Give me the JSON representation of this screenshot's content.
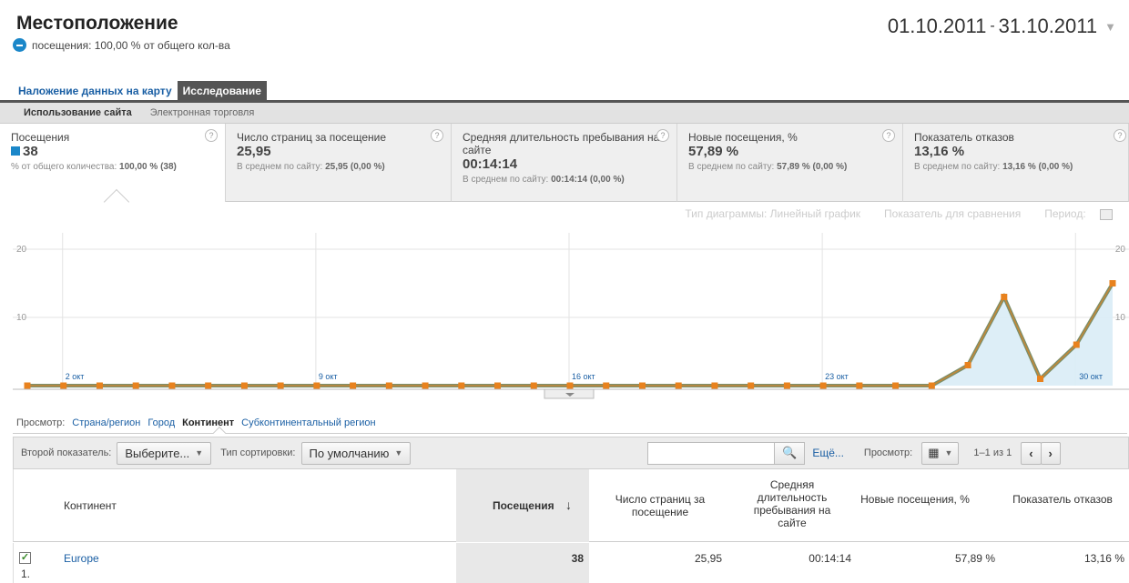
{
  "header": {
    "title": "Местоположение",
    "segment_label": "посещения: 100,00 % от общего кол-ва",
    "date_start": "01.10.2011",
    "date_sep": "-",
    "date_end": "31.10.2011"
  },
  "tabs": [
    {
      "label": "Наложение данных на карту"
    },
    {
      "label": "Исследование"
    }
  ],
  "subtabs": [
    {
      "label": "Использование сайта"
    },
    {
      "label": "Электронная торговля"
    }
  ],
  "metrics": [
    {
      "name": "Посещения",
      "value": "38",
      "sub": "% от общего количества: ",
      "sub_bold": "100,00 % (38)"
    },
    {
      "name": "Число страниц за посещение",
      "value": "25,95",
      "sub": "В среднем по сайту: ",
      "sub_bold": "25,95 (0,00 %)"
    },
    {
      "name": "Средняя длительность пребывания на сайте",
      "value": "00:14:14",
      "sub": "В среднем по сайту: ",
      "sub_bold": "00:14:14 (0,00 %)"
    },
    {
      "name": "Новые посещения, %",
      "value": "57,89 %",
      "sub": "В среднем по сайту: ",
      "sub_bold": "57,89 % (0,00 %)"
    },
    {
      "name": "Показатель отказов",
      "value": "13,16 %",
      "sub": "В среднем по сайту: ",
      "sub_bold": "13,16 % (0,00 %)"
    }
  ],
  "help_glyph": "?",
  "chart_tools": {
    "chart_type": "Тип диаграммы:",
    "line_chart": "Линейный график",
    "compare": "Показатель для сравнения",
    "period": "Период:"
  },
  "chart_data": {
    "type": "area",
    "ylim": [
      0,
      20
    ],
    "yticks_left": [
      "20",
      "10"
    ],
    "yticks_right": [
      "20",
      "10"
    ],
    "x_labels": [
      "2 окт",
      "9 окт",
      "16 окт",
      "23 окт",
      "30 окт"
    ],
    "x_label_days": [
      2,
      9,
      16,
      23,
      30
    ],
    "days": [
      1,
      2,
      3,
      4,
      5,
      6,
      7,
      8,
      9,
      10,
      11,
      12,
      13,
      14,
      15,
      16,
      17,
      18,
      19,
      20,
      21,
      22,
      23,
      24,
      25,
      26,
      27,
      28,
      29,
      30,
      31
    ],
    "series": [
      {
        "values": [
          0,
          0,
          0,
          0,
          0,
          0,
          0,
          0,
          0,
          0,
          0,
          0,
          0,
          0,
          0,
          0,
          0,
          0,
          0,
          0,
          0,
          0,
          0,
          0,
          0,
          0,
          3,
          13,
          1,
          6,
          15
        ]
      }
    ],
    "colors": {
      "line": "#7d8f69",
      "marker": "#e8821e",
      "fill": "#d9ecf6",
      "grid": "#e3e3e3"
    }
  },
  "view": {
    "label": "Просмотр:",
    "options": [
      "Страна/регион",
      "Город",
      "Континент",
      "Субконтинентальный регион"
    ],
    "selected": "Континент"
  },
  "toolbar": {
    "secondary_label": "Второй показатель:",
    "secondary_value": "Выберите...",
    "sort_label": "Тип сортировки:",
    "sort_value": "По умолчанию",
    "search_placeholder": "",
    "more_link": "Ещё...",
    "view_label": "Просмотр:",
    "pagination": "1–1 из 1"
  },
  "table": {
    "headers": {
      "dimension": "Континент",
      "visits": "Посещения",
      "pages": "Число страниц за посещение",
      "duration": "Средняя длительность пребывания на сайте",
      "new": "Новые посещения, %",
      "bounce": "Показатель отказов"
    },
    "sort_arrow": "↓",
    "rows": [
      {
        "index": "1.",
        "name": "Europe",
        "visits": "38",
        "pages": "25,95",
        "duration": "00:14:14",
        "new": "57,89 %",
        "bounce": "13,16 %"
      }
    ]
  }
}
